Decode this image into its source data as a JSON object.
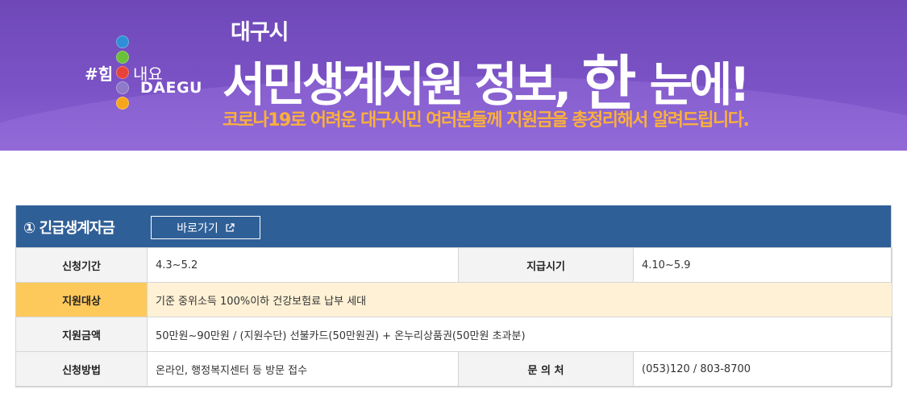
{
  "banner": {
    "logo": {
      "hashtag": "#힘",
      "naeyo": "내요",
      "city": "DAEGU",
      "dot_colors": [
        "#2f8fd6",
        "#6bbf3a",
        "#e8433a",
        "#8f79c9",
        "#f7a61b"
      ]
    },
    "title_small": "대구시",
    "title_main": "서민생계지원 정보,",
    "title_han": "한",
    "title_end": "눈에!",
    "subtitle": "코로나19로 어려운 대구시민 여러분들께 지원금을 총정리해서 알려드립니다."
  },
  "program": {
    "title": "① 긴급생계자금",
    "go_button": "바로가기",
    "rows": [
      {
        "label1": "신청기간",
        "value1": "4.3~5.2",
        "label2": "지급시기",
        "value2": "4.10~5.9"
      },
      {
        "label": "지원대상",
        "value": "기준 중위소득 100%이하 건강보험료 납부 세대"
      },
      {
        "label": "지원금액",
        "value": "50만원~90만원 / (지원수단) 선불카드(50만원권) + 온누리상품권(50만원 초과분)"
      },
      {
        "label1": "신청방법",
        "value1": "온라인, 행정복지센터 등 방문 접수",
        "label2": "문 의 처",
        "value2": "(053)120 / 803-8700"
      }
    ]
  },
  "colors": {
    "banner_purple": "#7b53c6",
    "subtitle_orange": "#fbb03b",
    "panel_blue": "#2f5f97",
    "highlight_label": "#fec95b",
    "highlight_value": "#fff1d6"
  }
}
